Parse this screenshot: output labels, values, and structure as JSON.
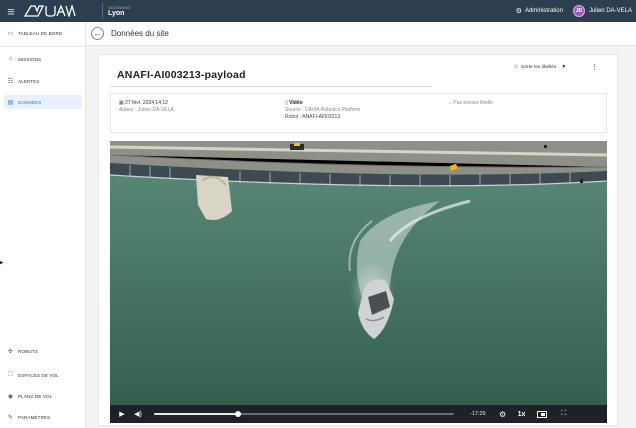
{
  "topbar": {
    "menu_icon": "hamburger-icon",
    "logo_text": "UAVIA",
    "site_label": "SCENARIO",
    "site_name": "Lyon",
    "admin_label": "Administration",
    "user_initials": "JD",
    "user_name": "Julien DA-VELA"
  },
  "sidebar": {
    "top_item": {
      "label": "TABLEAU DE BORD",
      "icon": "dashboard-icon"
    },
    "items": [
      {
        "label": "MISSIONS",
        "icon": "missions-icon"
      },
      {
        "label": "ALERTES",
        "icon": "alerts-icon"
      },
      {
        "label": "DONNÉES",
        "icon": "data-icon",
        "active": true
      }
    ],
    "bottom_items": [
      {
        "label": "ROBOTS",
        "icon": "robots-icon"
      },
      {
        "label": "ESPACES DE VOL",
        "icon": "flight-space-icon"
      },
      {
        "label": "PLANS DE VOL",
        "icon": "flight-plan-icon"
      },
      {
        "label": "PARAMÈTRES",
        "icon": "settings-icon"
      }
    ],
    "accent_color": "#2f7bd1"
  },
  "header": {
    "title": "Données du site"
  },
  "asset": {
    "title": "ANAFI-AI003213-payload",
    "manage_labels": "Gérer les libellés",
    "date": "27 févr. 2024 14:12",
    "author": "Auteur : Julien DA-VELA",
    "type": "Vidéo",
    "source": "Source : UAVIA Robotics Platform",
    "robot": "Robot : ANAFI-AI003213",
    "tags_placeholder": "Pas encore libellé"
  },
  "player": {
    "remaining_time": "-17:29",
    "speed": "1x",
    "progress_fraction": 0.28
  }
}
